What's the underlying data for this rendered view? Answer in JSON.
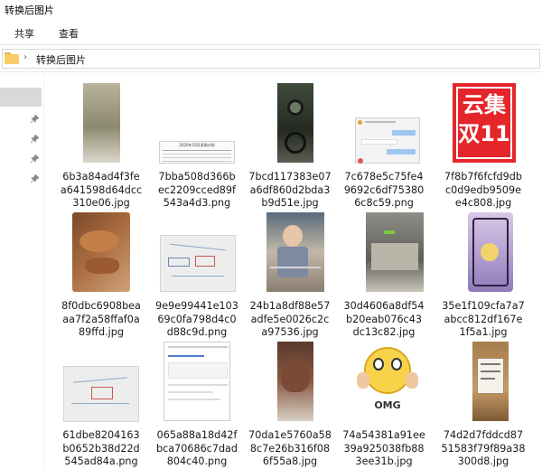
{
  "window": {
    "title": "转换后图片"
  },
  "ribbon": {
    "tabs": [
      "共享",
      "查看"
    ]
  },
  "address": {
    "path": "转换后图片"
  },
  "colors": {
    "promo_red": "#e4262b",
    "selection_gray": "#d9d9d9",
    "folder_yellow": "#f5cf66"
  },
  "files": [
    {
      "line1": "6b3a84ad4f3fe",
      "line2": "a641598d64dcc",
      "line3": "310e06.jpg",
      "icon": "image-icon"
    },
    {
      "line1": "7bba508d366b",
      "line2": "ec2209cced89f",
      "line3": "543a4d3.png",
      "icon": "image-icon"
    },
    {
      "line1": "7bcd117383e07",
      "line2": "a6df860d2bda3",
      "line3": "b9d51e.jpg",
      "icon": "image-icon"
    },
    {
      "line1": "7c678e5c75fe4",
      "line2": "9692c6df75380",
      "line3": "6c8c59.png",
      "icon": "image-icon"
    },
    {
      "line1": "7f8b7f6fcfd9db",
      "line2": "c0d9edb9509e",
      "line3": "e4c808.jpg",
      "icon": "image-icon"
    },
    {
      "line1": "8f0dbc6908bea",
      "line2": "aa7f2a58ffaf0a",
      "line3": "89ffd.jpg",
      "icon": "image-icon"
    },
    {
      "line1": "9e9e99441e103",
      "line2": "69c0fa798d4c0",
      "line3": "d88c9d.png",
      "icon": "image-icon"
    },
    {
      "line1": "24b1a8df88e57",
      "line2": "adfe5e0026c2c",
      "line3": "a97536.jpg",
      "icon": "image-icon"
    },
    {
      "line1": "30d4606a8df54",
      "line2": "b20eab076c43",
      "line3": "dc13c82.jpg",
      "icon": "image-icon"
    },
    {
      "line1": "35e1f109cfa7a7",
      "line2": "abcc812df167e",
      "line3": "1f5a1.jpg",
      "icon": "image-icon"
    },
    {
      "line1": "61dbe8204163",
      "line2": "b0652b38d22d",
      "line3": "545ad84a.png",
      "icon": "image-icon"
    },
    {
      "line1": "065a88a18d42f",
      "line2": "bca70686c7dad",
      "line3": "804c40.png",
      "icon": "image-icon"
    },
    {
      "line1": "70da1e5760a58",
      "line2": "8c7e26b316f08",
      "line3": "6f55a8.jpg",
      "icon": "image-icon"
    },
    {
      "line1": "74a54381a91ee",
      "line2": "39a925038fb88",
      "line3": "3ee31b.jpg",
      "icon": "image-icon"
    },
    {
      "line1": "74d2d7fddcd87",
      "line2": "51583f79f89a38",
      "line3": "300d8.jpg",
      "icon": "image-icon"
    }
  ],
  "thumb_text": {
    "promo_line1": "云集",
    "promo_line2": "双11",
    "doc_heading": "2020年10月采购计划",
    "emoji_caption": "OMG"
  }
}
